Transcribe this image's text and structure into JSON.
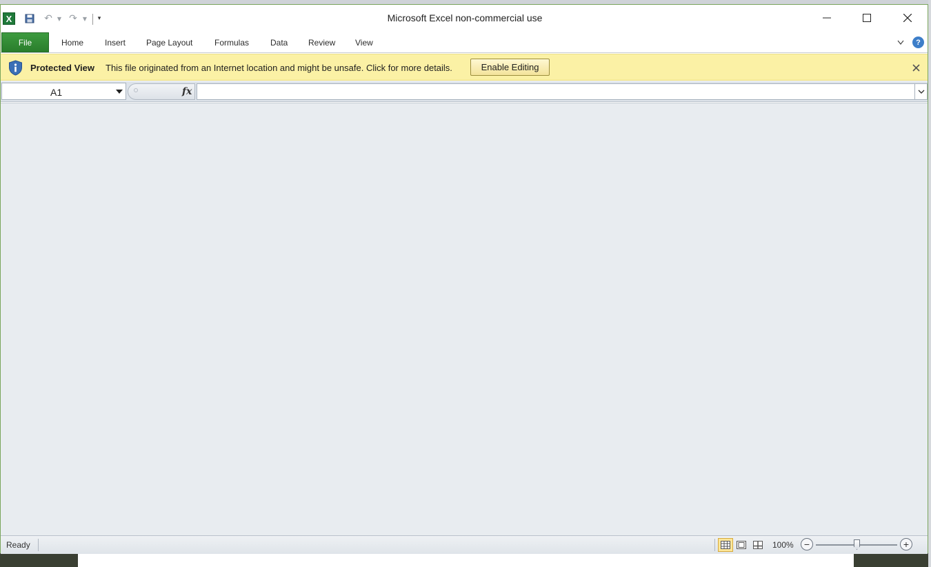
{
  "window": {
    "title": "Microsoft Excel non-commercial use"
  },
  "app_logo": "X",
  "ribbon": {
    "file_tab": "File",
    "tabs": [
      {
        "label": "Home"
      },
      {
        "label": "Insert"
      },
      {
        "label": "Page Layout"
      },
      {
        "label": "Formulas"
      },
      {
        "label": "Data"
      },
      {
        "label": "Review"
      },
      {
        "label": "View"
      }
    ],
    "help_label": "?"
  },
  "protected_view": {
    "title": "Protected View",
    "message": "This file originated from an Internet location and might be unsafe. Click for more details.",
    "enable_button": "Enable Editing"
  },
  "formula_bar": {
    "name_box": "A1",
    "fx_label": "fx",
    "formula": ""
  },
  "status_bar": {
    "status": "Ready",
    "zoom": "100%",
    "zoom_level_percent": 100
  },
  "icons": {
    "save": "save-icon",
    "undo": "undo-icon",
    "redo": "redo-icon",
    "shield": "shield-info-icon"
  },
  "colors": {
    "file_tab": "#2a7d2c",
    "protected_bar": "#fbf1a5",
    "workspace": "#e8ecf0"
  }
}
